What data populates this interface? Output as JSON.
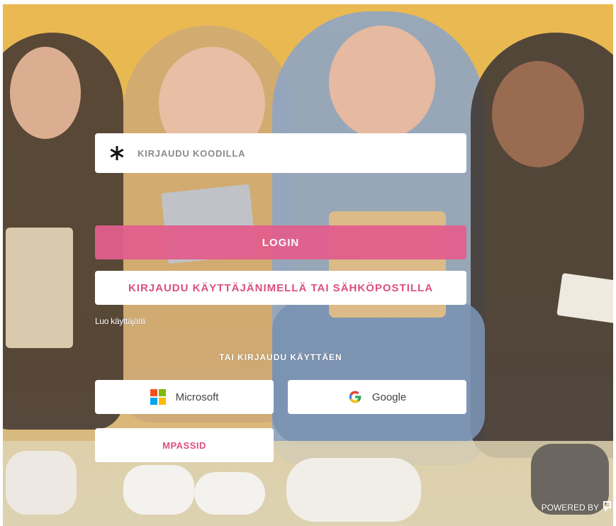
{
  "login_code": {
    "placeholder": "KIRJAUDU KOODILLA",
    "icon": "asterisk-icon"
  },
  "buttons": {
    "login_label": "LOGIN",
    "username_login_label": "KIRJAUDU KÄYTTÄJÄNIMELLÄ TAI SÄHKÖPOSTILLA",
    "microsoft_label": "Microsoft",
    "google_label": "Google",
    "mpassid_label": "MPASSID"
  },
  "links": {
    "create_account": "Luo käyttäjätili"
  },
  "headings": {
    "alt_login": "TAI KIRJAUDU KÄYTTÄEN"
  },
  "footer": {
    "powered_by": "POWERED BY"
  },
  "colors": {
    "accent": "#e25f8d",
    "accent_text": "#dd4f7e",
    "background": "#e8b23f",
    "microsoft": [
      "#f25022",
      "#7fba00",
      "#00a4ef",
      "#ffb900"
    ],
    "google": [
      "#4285f4",
      "#ea4335",
      "#fbbc05",
      "#34a853"
    ]
  }
}
